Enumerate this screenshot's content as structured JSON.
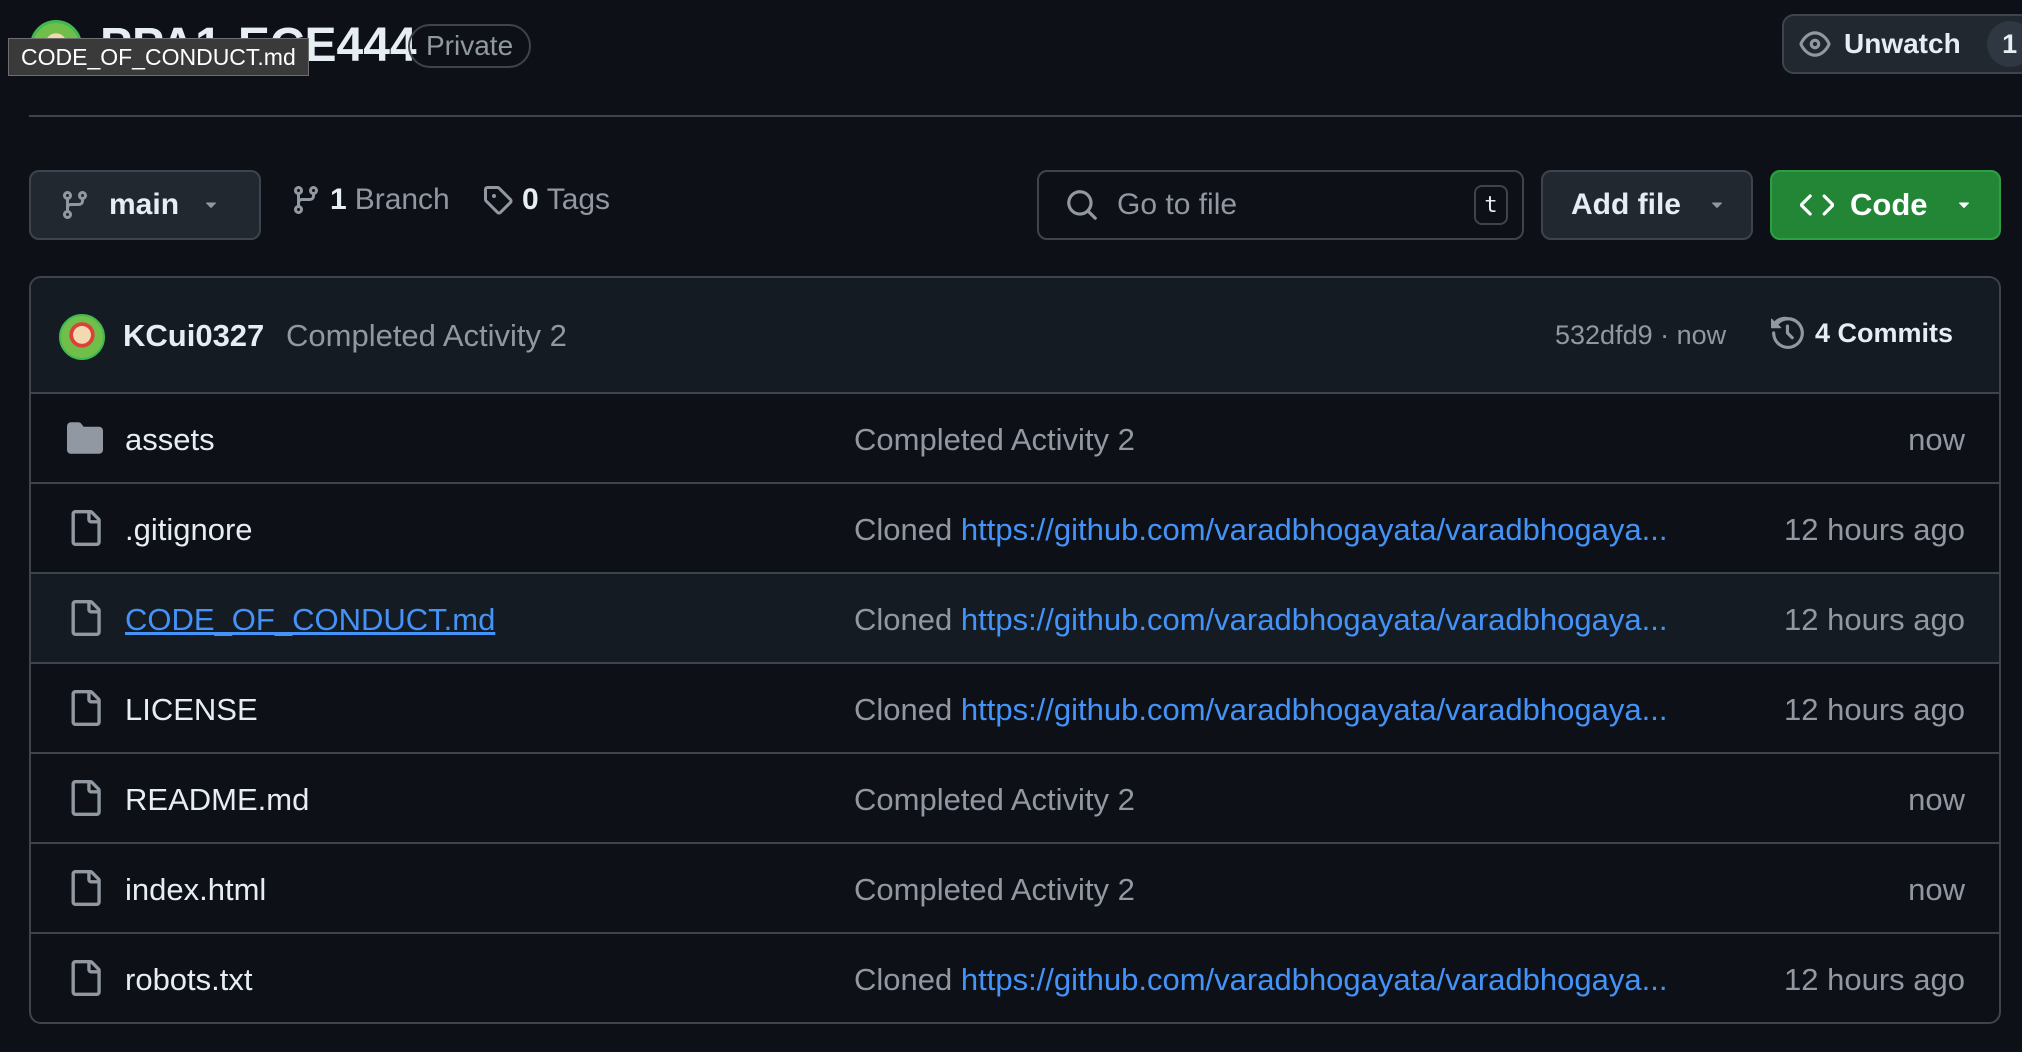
{
  "header": {
    "repo_name": "PPA1-ECE444",
    "visibility_badge": "Private",
    "tooltip_text": "CODE_OF_CONDUCT.md",
    "unwatch_label": "Unwatch",
    "watch_count": "1"
  },
  "toolbar": {
    "branch_name": "main",
    "branch_count": "1",
    "branch_label": "Branch",
    "tag_count": "0",
    "tag_label": "Tags",
    "search_placeholder": "Go to file",
    "search_shortcut": "t",
    "add_file_label": "Add file",
    "code_label": "Code"
  },
  "latest_commit": {
    "author": "KCui0327",
    "message": "Completed Activity 2",
    "sha_time": "532dfd9 · now",
    "commits_label": "4 Commits"
  },
  "files": [
    {
      "name": "assets",
      "type": "folder",
      "message": "Completed Activity 2",
      "message_prefix": "",
      "message_link": "",
      "time": "now"
    },
    {
      "name": ".gitignore",
      "type": "file",
      "message": "",
      "message_prefix": "Cloned ",
      "message_link": "https://github.com/varadbhogayata/varadbhogaya...",
      "time": "12 hours ago"
    },
    {
      "name": "CODE_OF_CONDUCT.md",
      "type": "file",
      "message": "",
      "message_prefix": "Cloned ",
      "message_link": "https://github.com/varadbhogayata/varadbhogaya...",
      "time": "12 hours ago"
    },
    {
      "name": "LICENSE",
      "type": "file",
      "message": "",
      "message_prefix": "Cloned ",
      "message_link": "https://github.com/varadbhogayata/varadbhogaya...",
      "time": "12 hours ago"
    },
    {
      "name": "README.md",
      "type": "file",
      "message": "Completed Activity 2",
      "message_prefix": "",
      "message_link": "",
      "time": "now"
    },
    {
      "name": "index.html",
      "type": "file",
      "message": "Completed Activity 2",
      "message_prefix": "",
      "message_link": "",
      "time": "now"
    },
    {
      "name": "robots.txt",
      "type": "file",
      "message": "",
      "message_prefix": "Cloned ",
      "message_link": "https://github.com/varadbhogayata/varadbhogaya...",
      "time": "12 hours ago"
    }
  ],
  "colors": {
    "background": "#0d1117",
    "border": "#3d444d",
    "link": "#4493f8",
    "code_button": "#238636",
    "muted_text": "#9198a1"
  },
  "icons": [
    "repo-avatar",
    "eye-icon",
    "git-branch-icon",
    "tag-icon",
    "search-icon",
    "triangle-down-icon",
    "code-icon",
    "history-icon",
    "folder-icon",
    "file-icon"
  ]
}
